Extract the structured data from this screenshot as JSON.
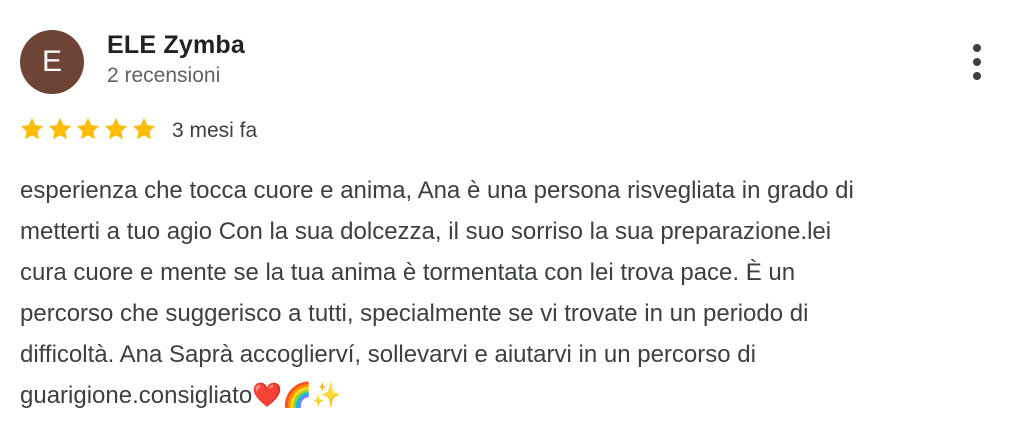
{
  "reviewer": {
    "initial": "E",
    "name": "ELE Zymba",
    "review_count": "2 recensioni",
    "avatar_color": "#6d4436"
  },
  "menu": {
    "icon": "more-vertical-icon"
  },
  "rating": {
    "stars": 5,
    "max_stars": 5,
    "star_color": "#fbbc04",
    "date": "3 mesi fa"
  },
  "review": {
    "text": "esperienza che tocca cuore e anima, Ana è una persona risvegliata in grado di\nmetterti a tuo agio Con la sua dolcezza, il suo sorriso la sua preparazione.lei\ncura cuore e mente se la tua anima è tormentata con lei trova pace. È un\npercorso che suggerisco a tutti, specialmente se vi trovate in un periodo di\ndifficoltà. Ana Saprà accoglierví, sollevarvi e aiutarvi in un percorso di\nguarigione.consigliato❤️🌈✨"
  }
}
